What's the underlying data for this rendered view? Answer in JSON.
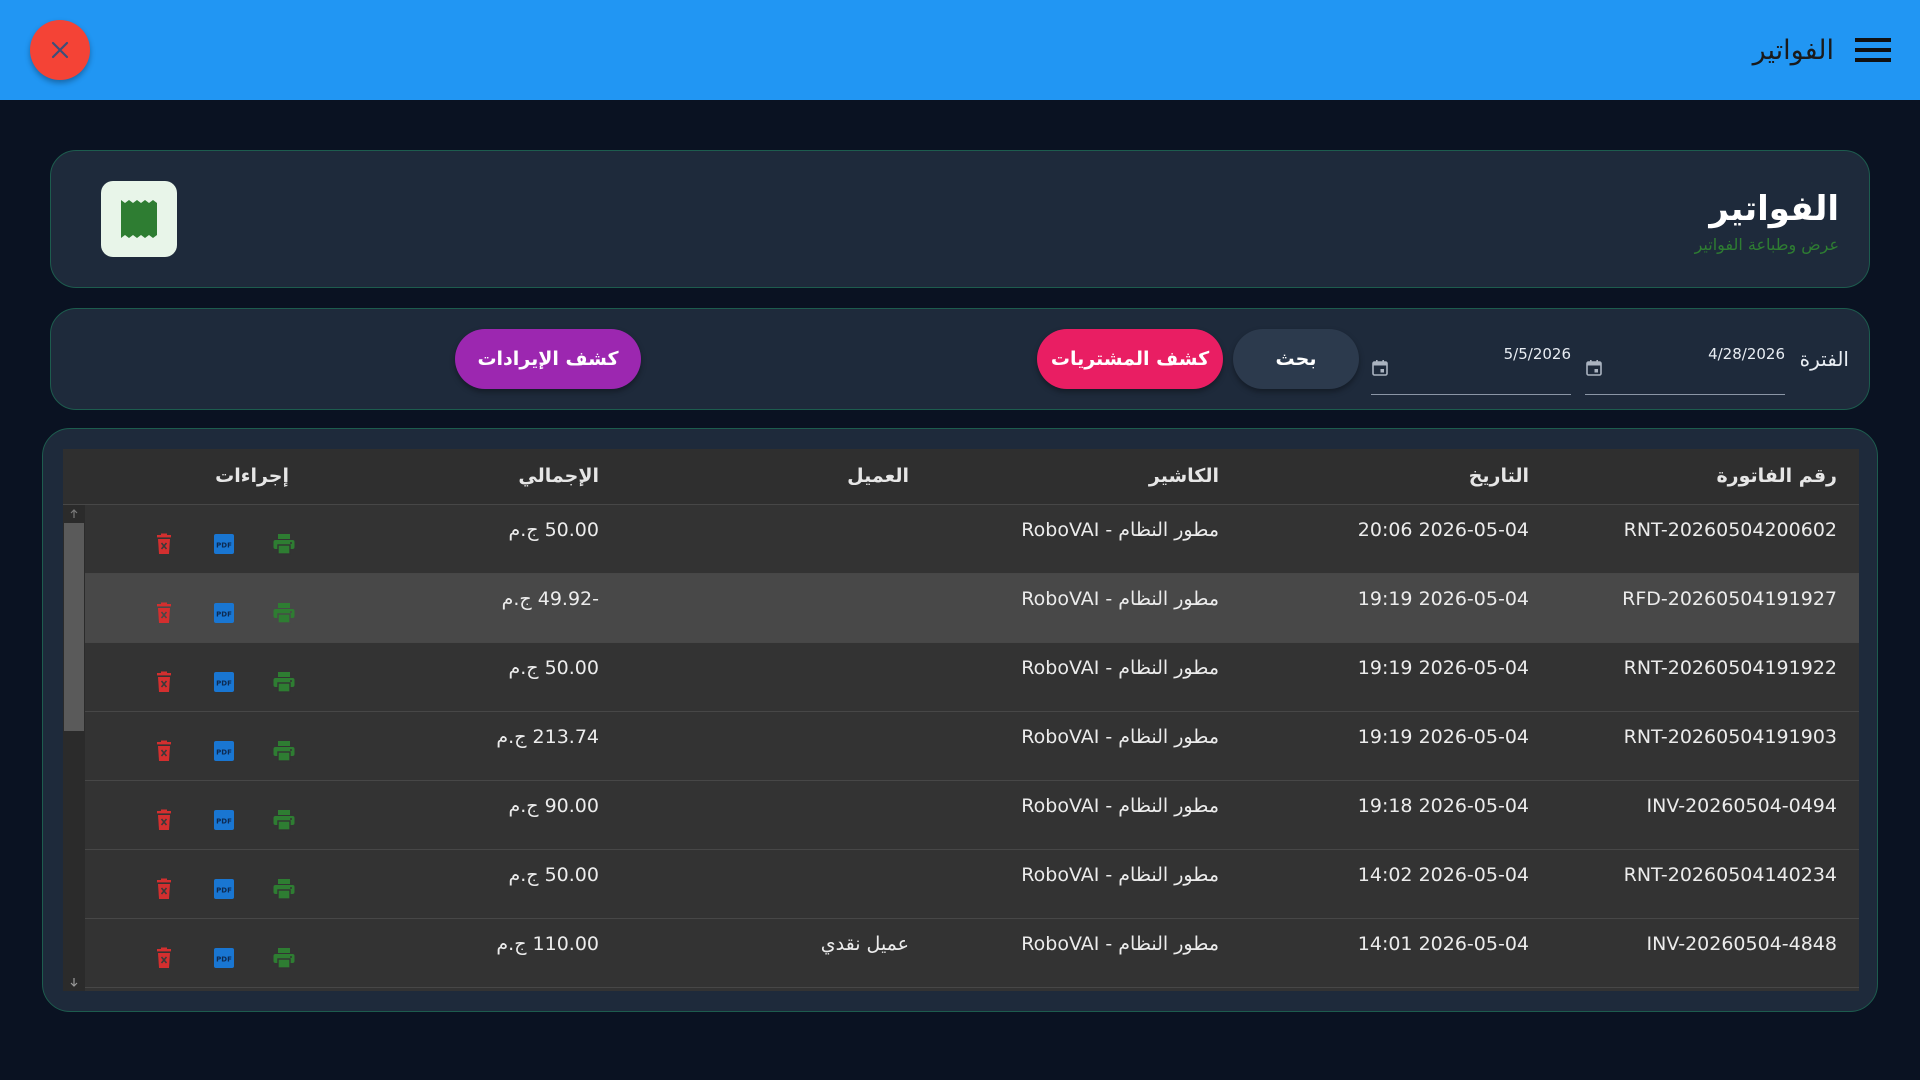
{
  "appbar": {
    "title": "الفواتير"
  },
  "header": {
    "title": "الفواتير",
    "subtitle": "عرض وطباعة الفواتير"
  },
  "filter": {
    "period_label": "الفترة",
    "date_from": "4/28/2026",
    "date_to": "5/5/2026",
    "search_label": "بحث",
    "purchases_label": "كشف المشتريات",
    "revenue_label": "كشف الإيرادات"
  },
  "table": {
    "headers": {
      "invoice_no": "رقم الفاتورة",
      "date": "التاريخ",
      "cashier": "الكاشير",
      "client": "العميل",
      "total": "الإجمالي",
      "actions": "إجراءات"
    },
    "rows": [
      {
        "invoice_no": "RNT-20260504200602",
        "date": "2026-05-04 20:06",
        "cashier": "مطور النظام - RoboVAI",
        "client": "",
        "total": "50.00 ج.م"
      },
      {
        "invoice_no": "RFD-20260504191927",
        "date": "2026-05-04 19:19",
        "cashier": "مطور النظام - RoboVAI",
        "client": "",
        "total": "-49.92 ج.م"
      },
      {
        "invoice_no": "RNT-20260504191922",
        "date": "2026-05-04 19:19",
        "cashier": "مطور النظام - RoboVAI",
        "client": "",
        "total": "50.00 ج.م"
      },
      {
        "invoice_no": "RNT-20260504191903",
        "date": "2026-05-04 19:19",
        "cashier": "مطور النظام - RoboVAI",
        "client": "",
        "total": "213.74 ج.م"
      },
      {
        "invoice_no": "INV-20260504-0494",
        "date": "2026-05-04 19:18",
        "cashier": "مطور النظام - RoboVAI",
        "client": "",
        "total": "90.00 ج.م"
      },
      {
        "invoice_no": "RNT-20260504140234",
        "date": "2026-05-04 14:02",
        "cashier": "مطور النظام - RoboVAI",
        "client": "",
        "total": "50.00 ج.م"
      },
      {
        "invoice_no": "INV-20260504-4848",
        "date": "2026-05-04 14:01",
        "cashier": "مطور النظام - RoboVAI",
        "client": "عميل نقدي",
        "total": "110.00 ج.م"
      }
    ]
  },
  "colors": {
    "appbar": "#2196f3",
    "close": "#f44336",
    "purchases": "#e91e63",
    "revenue": "#9c27b0",
    "print_icon": "#2e7d32",
    "pdf_icon": "#1976d2",
    "delete_icon": "#d32f2f"
  },
  "icons": {
    "menu": "menu-icon",
    "close": "close-icon",
    "receipt": "receipt-icon",
    "calendar": "calendar-icon",
    "print": "print-icon",
    "pdf": "pdf-icon",
    "delete": "delete-icon"
  }
}
